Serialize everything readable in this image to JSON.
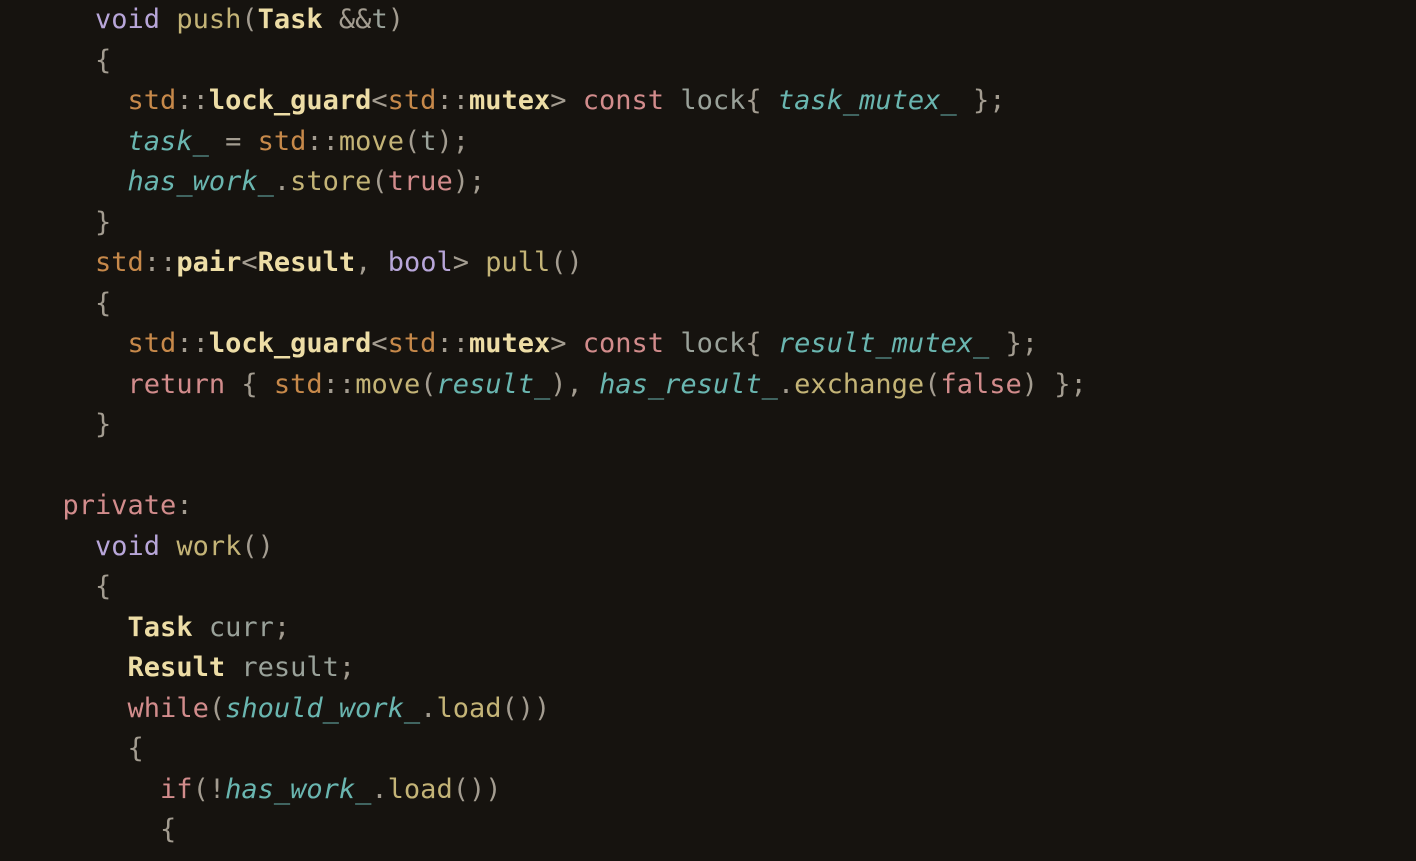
{
  "tokens": {
    "kw_void": "void",
    "kw_bool": "bool",
    "kw_const": "const",
    "kw_return": "return",
    "kw_private": "private",
    "kw_while": "while",
    "kw_if": "if",
    "kw_true": "true",
    "kw_false": "false",
    "ns_std": "std",
    "fn_push": "push",
    "fn_pull": "pull",
    "fn_work": "work",
    "fn_move": "move",
    "fn_store": "store",
    "fn_load": "load",
    "fn_exchange": "exchange",
    "ty_Task": "Task",
    "ty_Result": "Result",
    "ty_lock_guard": "lock_guard",
    "ty_mutex": "mutex",
    "ty_pair": "pair",
    "id_lock": "lock",
    "id_t": "t",
    "id_curr": "curr",
    "id_result": "result",
    "m_task_": "task_",
    "m_has_work_": "has_work_",
    "m_task_mutex_": "task_mutex_",
    "m_result_mutex_": "result_mutex_",
    "m_result_": "result_",
    "m_has_result_": "has_result_",
    "m_should_work_": "should_work_"
  }
}
